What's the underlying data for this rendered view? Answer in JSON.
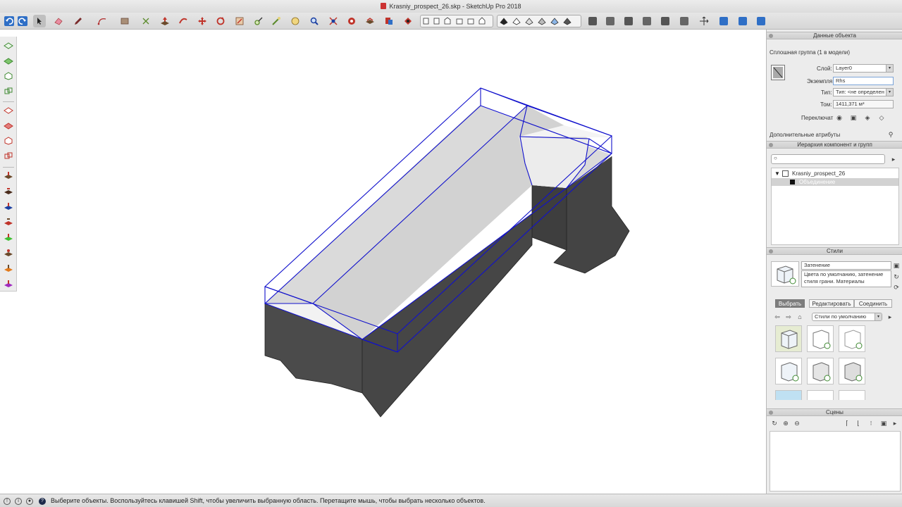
{
  "window": {
    "title": "Krasniy_prospect_26.skp - SketchUp Pro 2018"
  },
  "toolbar": {
    "icons": [
      "undo-icon",
      "redo-icon",
      "select-icon",
      "eraser-icon",
      "pencil-icon",
      "arc-icon",
      "shapes-icon",
      "tape-icon",
      "paint-icon",
      "push-pull-icon",
      "move-icon",
      "rotate-icon",
      "scale-icon",
      "offset-icon",
      "follow-me-icon",
      "orbit-icon",
      "zoom-icon",
      "zoom-extents-icon",
      "section-icon",
      "section-fill-icon",
      "section-display-icon"
    ],
    "colors": {
      "red": "#c0342a",
      "green": "#3f8a32",
      "blue": "#1b3fa1"
    }
  },
  "object_info": {
    "header": "Данные объекта",
    "summary": "Сплошная группа (1 в модели)",
    "layer_label": "Слой:",
    "layer_value": "Layer0",
    "instance_label": "Экземпля",
    "instance_value": "Rhs",
    "type_label": "Тип:",
    "type_value": "Тип: <не определен",
    "volume_label": "Том:",
    "volume_value": "1411,371 м³",
    "toggles_label": "Переключат",
    "advanced_label": "Дополнительные атрибуты"
  },
  "outliner": {
    "header": "Иерархия компонент и групп",
    "search_placeholder": "",
    "root": "Krasniy_prospect_26",
    "child": "Объединение"
  },
  "styles": {
    "header": "Стили",
    "style_name": "Затенение",
    "style_desc": "Цвета по умолчанию, затенение стиля грани. Материалы",
    "tabs": [
      "Выбрать",
      "Редактировать",
      "Соединить"
    ],
    "library": "Стили по умолчанию"
  },
  "scenes": {
    "header": "Сцены"
  },
  "status": {
    "message": "Выберите объекты. Воспользуйтесь клавишей Shift, чтобы увеличить выбранную область. Перетащите мышь, чтобы выбрать несколько объектов."
  }
}
